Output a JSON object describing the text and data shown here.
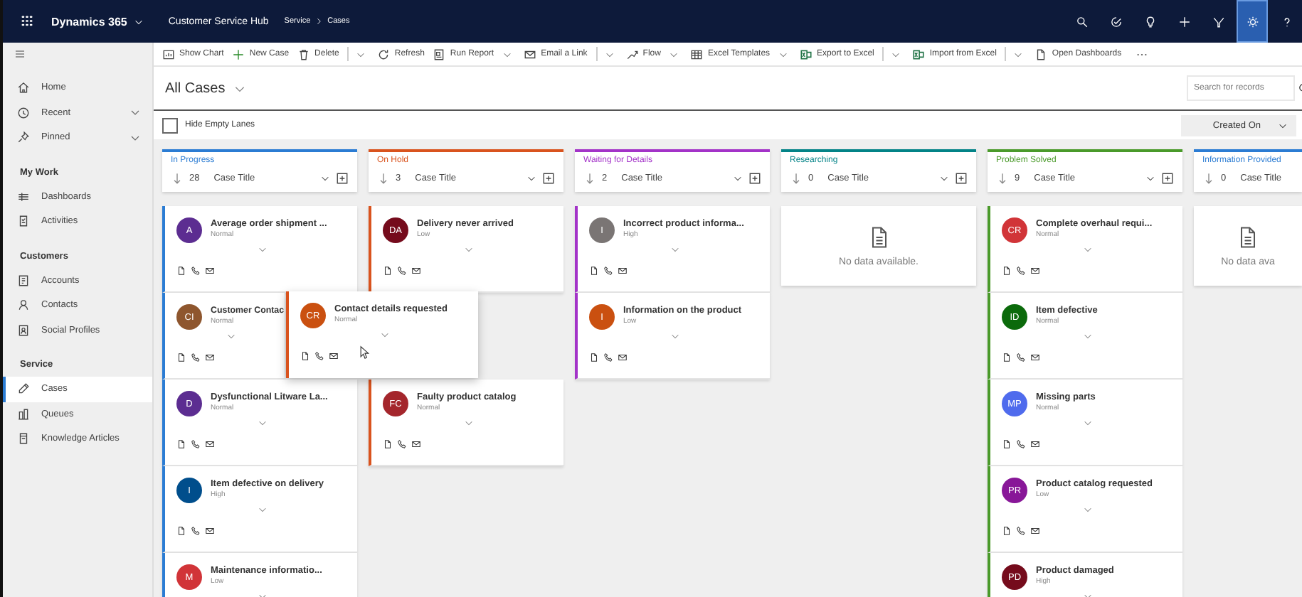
{
  "app_bar": {
    "app_name": "Dynamics 365",
    "area": "Customer Service Hub",
    "breadcrumb": [
      "Service",
      "Cases"
    ],
    "actions": [
      {
        "selected": false
      },
      {
        "selected": false
      },
      {
        "selected": false
      },
      {
        "selected": false
      },
      {
        "selected": false
      },
      {
        "selected": true
      },
      {
        "selected": false
      }
    ]
  },
  "sidebar": {
    "top_items": [
      {
        "label": "Home",
        "expandable": false
      },
      {
        "label": "Recent",
        "expandable": true
      },
      {
        "label": "Pinned",
        "expandable": true
      }
    ],
    "groups": [
      {
        "title": "My Work",
        "items": [
          {
            "label": "Dashboards",
            "selected": false
          },
          {
            "label": "Activities",
            "selected": false
          }
        ]
      },
      {
        "title": "Customers",
        "items": [
          {
            "label": "Accounts",
            "selected": false
          },
          {
            "label": "Contacts",
            "selected": false
          },
          {
            "label": "Social Profiles",
            "selected": false
          }
        ]
      },
      {
        "title": "Service",
        "items": [
          {
            "label": "Cases",
            "selected": true
          },
          {
            "label": "Queues",
            "selected": false
          },
          {
            "label": "Knowledge Articles",
            "selected": false
          }
        ]
      }
    ]
  },
  "toolbar": [
    {
      "kind": "command",
      "label": "Show Chart",
      "menu": false,
      "divider": false
    },
    {
      "kind": "command",
      "label": "New Case",
      "menu": false,
      "divider": false
    },
    {
      "kind": "command",
      "label": "Delete",
      "menu": true,
      "divider": true
    },
    {
      "kind": "command",
      "label": "Refresh",
      "menu": false,
      "divider": false
    },
    {
      "kind": "command",
      "label": "Run Report",
      "menu": true,
      "divider": false
    },
    {
      "kind": "command",
      "label": "Email a Link",
      "menu": true,
      "divider": true
    },
    {
      "kind": "command",
      "label": "Flow",
      "menu": true,
      "divider": false
    },
    {
      "kind": "command",
      "label": "Excel Templates",
      "menu": true,
      "divider": false
    },
    {
      "kind": "command",
      "label": "Export to Excel",
      "menu": true,
      "divider": true
    },
    {
      "kind": "command",
      "label": "Import from Excel",
      "menu": true,
      "divider": true
    },
    {
      "kind": "command",
      "label": "Open Dashboards",
      "menu": false,
      "divider": false
    },
    {
      "kind": "overflow"
    }
  ],
  "view": {
    "title": "All Cases",
    "search": {
      "placeholder": "Search for records"
    },
    "hide_empty_lanes": {
      "label": "Hide Empty Lanes",
      "checked": false
    },
    "sort": {
      "label": "Created On"
    }
  },
  "lanes": [
    {
      "title": "In Progress",
      "color": "#2b7cd3",
      "count": "28",
      "sort_field": "Case Title",
      "cards": [
        {
          "kind": "case",
          "initials": "A",
          "color": "#5c2d91",
          "title": "Average order shipment ...",
          "priority": "Normal"
        },
        {
          "kind": "covered_case",
          "initials": "CI",
          "color": "#8e562e",
          "title": "Customer Contac",
          "priority": "Normal"
        },
        {
          "kind": "case",
          "initials": "D",
          "color": "#5c2d91",
          "title": "Dysfunctional Litware La...",
          "priority": "Normal"
        },
        {
          "kind": "case",
          "initials": "I",
          "color": "#004e8c",
          "title": "Item defective on delivery",
          "priority": "High"
        },
        {
          "kind": "cut_case",
          "initials": "M",
          "color": "#d13438",
          "title": "Maintenance informatio...",
          "priority": "Low"
        }
      ]
    },
    {
      "title": "On Hold",
      "color": "#d9531e",
      "count": "3",
      "sort_field": "Case Title",
      "cards": [
        {
          "kind": "case",
          "initials": "DA",
          "color": "#750b1c",
          "title": "Delivery never arrived",
          "priority": "Low"
        },
        {
          "kind": "dragging",
          "initials": "CR",
          "color": "#ca5010",
          "title": "Contact details requested",
          "priority": "Normal"
        },
        {
          "kind": "case",
          "initials": "FC",
          "color": "#a4262c",
          "title": "Faulty product catalog",
          "priority": "Normal"
        }
      ]
    },
    {
      "title": "Waiting for Details",
      "color": "#a333c8",
      "count": "2",
      "sort_field": "Case Title",
      "cards": [
        {
          "kind": "case",
          "initials": "I",
          "color": "#7a7574",
          "title": "Incorrect product informa...",
          "priority": "High"
        },
        {
          "kind": "case",
          "initials": "I",
          "color": "#ca5010",
          "title": "Information on the product",
          "priority": "Low"
        }
      ]
    },
    {
      "title": "Researching",
      "color": "#038387",
      "count": "0",
      "sort_field": "Case Title",
      "empty_text": "No data available."
    },
    {
      "title": "Problem Solved",
      "color": "#4a9a2a",
      "count": "9",
      "sort_field": "Case Title",
      "cards": [
        {
          "kind": "case",
          "initials": "CR",
          "color": "#d13438",
          "title": "Complete overhaul requi...",
          "priority": "Normal"
        },
        {
          "kind": "case",
          "initials": "ID",
          "color": "#0b6a0b",
          "title": "Item defective",
          "priority": "Normal"
        },
        {
          "kind": "case",
          "initials": "MP",
          "color": "#4f6bed",
          "title": "Missing parts",
          "priority": "Normal"
        },
        {
          "kind": "case",
          "initials": "PR",
          "color": "#881798",
          "title": "Product catalog requested",
          "priority": "Low"
        },
        {
          "kind": "cut_case",
          "initials": "PD",
          "color": "#750b1c",
          "title": "Product damaged",
          "priority": "High"
        }
      ]
    },
    {
      "title": "Information Provided",
      "color": "#2b7cd3",
      "count": "0",
      "sort_field": "Case Title",
      "empty_text": "No data ava"
    }
  ]
}
